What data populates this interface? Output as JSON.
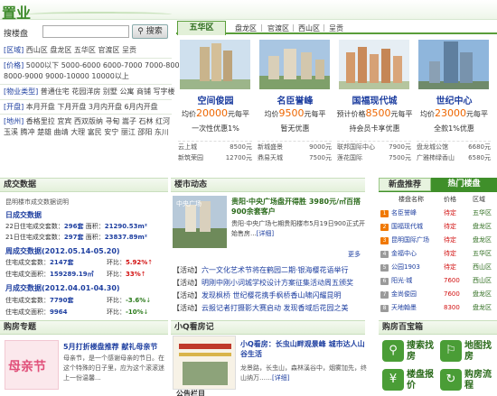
{
  "header": {
    "logo": "置业"
  },
  "search": {
    "label": "搜楼盘",
    "placeholder": "",
    "button": "搜索"
  },
  "filters": {
    "district": {
      "label": "[区域]",
      "items": [
        "西山区",
        "盘龙区",
        "五华区",
        "官渡区",
        "呈贡"
      ]
    },
    "price": {
      "label": "[价格]",
      "items": [
        "5000以下",
        "5000-6000",
        "6000-7000",
        "7000-8000",
        "8000-9000",
        "9000-10000",
        "10000以上"
      ]
    },
    "type": {
      "label": "[物业类型]",
      "items": [
        "普通住宅",
        "花园洋房",
        "别墅",
        "公寓",
        "商铺",
        "写字楼"
      ]
    },
    "open": {
      "label": "[开盘]",
      "items": [
        "本月开盘",
        "下月开盘",
        "3月内开盘",
        "6月内开盘"
      ]
    },
    "area": {
      "label": "[地州]",
      "items": [
        "香格里拉",
        "宜宾",
        "西双版纳",
        "寻甸",
        "嵩子",
        "石林",
        "红河",
        "玉溪",
        "腾冲",
        "楚雄",
        "曲靖",
        "大理",
        "富民",
        "安宁",
        "丽江",
        "邵阳",
        "东川"
      ]
    }
  },
  "district_tabs": [
    "五华区",
    "盘龙区",
    "官渡区",
    "西山区",
    "呈贡"
  ],
  "cards": [
    {
      "name": "空间俊园",
      "price_prefix": "均价",
      "price": "20000",
      "price_unit": "元每平",
      "promo": "一次性优惠1%",
      "rows": [
        [
          "云上城",
          "8500元"
        ],
        [
          "新筑荣园",
          "12700元"
        ]
      ]
    },
    {
      "name": "名臣誉峰",
      "price_prefix": "均价",
      "price": "9500",
      "price_unit": "元每平",
      "promo": "暂无优惠",
      "rows": [
        [
          "新城盛景",
          "9000元"
        ],
        [
          "鼎易天城",
          "7500元"
        ]
      ]
    },
    {
      "name": "国福现代城",
      "price_prefix": "预计价格",
      "price": "8500",
      "price_unit": "元每平",
      "promo": "持会员卡享优惠",
      "rows": [
        [
          "联邦国际中心",
          "7900元"
        ],
        [
          "莲花国际",
          "7500元"
        ]
      ]
    },
    {
      "name": "世纪中心",
      "price_prefix": "均价",
      "price": "23000",
      "price_unit": "元每平",
      "promo": "全款1%优惠",
      "rows": [
        [
          "盘龙城公馆",
          "6680元"
        ],
        [
          "广雅柿绿香山",
          "6580元"
        ]
      ]
    }
  ],
  "deals": {
    "title": "成交数据",
    "note": "昆明楼市成交数据说明",
    "daily": {
      "title": "日成交数据",
      "rows": [
        {
          "label": "22日住宅成交套数：",
          "count": "296套",
          "area_label": "面积：",
          "area": "21290.53m²"
        },
        {
          "label": "21日住宅成交套数：",
          "count": "297套",
          "area_label": "面积：",
          "area": "23837.89m²"
        }
      ]
    },
    "weekly": {
      "title": "周成交数据",
      "period": "(2012.05.14-05.20)",
      "rows": [
        {
          "label": "住宅成交套数：",
          "value": "2147套",
          "cmp_label": "环比：",
          "cmp": "5.92%",
          "dir": "up"
        },
        {
          "label": "住宅成交面积：",
          "value": "159289.19㎡",
          "cmp_label": "环比：",
          "cmp": "33%",
          "dir": "up"
        }
      ]
    },
    "monthly": {
      "title": "月成交数据",
      "period": "(2012.04.01-04.30)",
      "rows": [
        {
          "label": "住宅成交套数：",
          "value": "7790套",
          "cmp_label": "环比：",
          "cmp": "-3.6%",
          "dir": "down"
        },
        {
          "label": "住宅成交面积：",
          "value": "9964",
          "cmp_label": "环比：",
          "cmp": "-10%",
          "dir": "down"
        }
      ]
    }
  },
  "news": {
    "title": "楼市动态",
    "headline": "贵阳·中央广场盘开得胜 3980元/㎡百搭900余套客户",
    "summary": "贵阳·中央广场七期贵阳楼市5月19日900正式开始售房...",
    "summary_link": "[详细]",
    "more": "更多",
    "thumb_text": "中央广场",
    "items": [
      {
        "tag": "【活动】",
        "text": "六一文化艺术节将在鹤园二期·银海樱花语举行"
      },
      {
        "tag": "【活动】",
        "text": "明刚中刚小词城学校设计方案征集活动周五颁奖"
      },
      {
        "tag": "【活动】",
        "text": "发现枫桥 世纪樱花携手枫桥香山啸闪耀昆明"
      },
      {
        "tag": "【活动】",
        "text": "云报记者打摄影大赛启动 发现香域后花园之美"
      }
    ]
  },
  "recommend": {
    "tab_new": "新盘推荐",
    "tab_hot": "热门楼盘",
    "columns": [
      "楼盘名称",
      "价格",
      "区域"
    ],
    "rows": [
      {
        "num": "1",
        "name": "名臣誉峰",
        "price": "待定",
        "district": "五华区"
      },
      {
        "num": "2",
        "name": "国福现代城",
        "price": "待定",
        "district": "盘龙区"
      },
      {
        "num": "3",
        "name": "昆明国际广场",
        "price": "待定",
        "district": "盘龙区"
      },
      {
        "num": "4",
        "name": "金福中心",
        "price": "待定",
        "district": "五华区"
      },
      {
        "num": "5",
        "name": "公园1903",
        "price": "待定",
        "district": "西山区"
      },
      {
        "num": "6",
        "name": "阳光·城",
        "price": "7600",
        "district": "西山区"
      },
      {
        "num": "7",
        "name": "金尚俊园",
        "price": "7600",
        "district": "盘龙区"
      },
      {
        "num": "8",
        "name": "天地翰墨",
        "price": "8300",
        "district": "盘龙区"
      }
    ]
  },
  "topic": {
    "title": "购房专题",
    "image_text": "母亲节",
    "headline": "5月打折楼盘推荐 献礼母亲节",
    "summary": "母亲节，是一个感谢母亲的节日。在这个特殊的日子里，应为这个滚滚迷上一份温馨..."
  },
  "small_talk": {
    "title": "小Q看房记",
    "headline": "小Q看房：长虫山畔观景峰 城市达人山谷生活",
    "summary": "龙景路，长虫山，森林溪谷中，烟雾加先，终山纳万……",
    "summary_link": "[详细]",
    "bottom": "公告栏目"
  },
  "toolbox": {
    "title": "购房百宝箱",
    "tools": [
      {
        "label": "搜索找房",
        "icon": "search-icon"
      },
      {
        "label": "地图找房",
        "icon": "map-icon"
      },
      {
        "label": "楼盘报价",
        "icon": "price-icon"
      },
      {
        "label": "购房流程",
        "icon": "flow-icon"
      }
    ]
  }
}
